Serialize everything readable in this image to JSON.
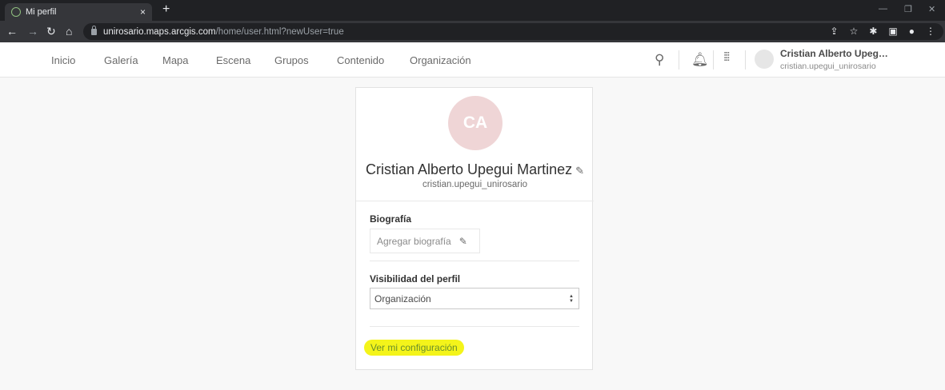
{
  "browser": {
    "tab_title": "Mi perfil",
    "tab_close": "×",
    "new_tab": "+",
    "url_host": "unirosario.maps.arcgis.com",
    "url_path": "/home/user.html?newUser=true",
    "icons": [
      "back-icon",
      "forward-icon",
      "reload-icon",
      "home-icon",
      "lock-icon",
      "share-icon",
      "star-icon",
      "extensions-icon",
      "sidepanel-icon",
      "profile-icon",
      "menu-icon"
    ]
  },
  "nav": {
    "items": [
      "Inicio",
      "Galería",
      "Mapa",
      "Escena",
      "Grupos",
      "Contenido",
      "Organización"
    ]
  },
  "header_user": {
    "name": "Cristian Alberto Upeg…",
    "username": "cristian.upegui_unirosario"
  },
  "profile": {
    "initials": "CA",
    "full_name": "Cristian Alberto Upegui Martinez",
    "username": "cristian.upegui_unirosario",
    "bio_label": "Biografía",
    "bio_placeholder": "Agregar biografía",
    "visibility_label": "Visibilidad del perfil",
    "visibility_value": "Organización",
    "settings_link": "Ver mi configuración"
  },
  "colors": {
    "avatar_bg": "#efd5d6",
    "highlight": "#f4f41a",
    "link": "#6a8f2a"
  }
}
